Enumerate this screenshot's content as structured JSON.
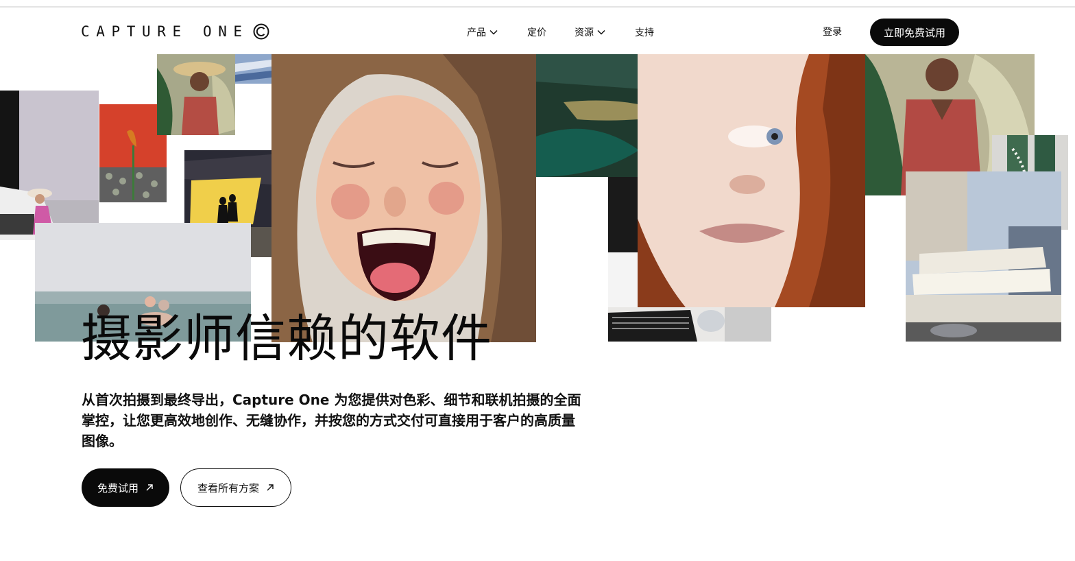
{
  "header": {
    "logo_text": "CAPTURE ONE",
    "nav": [
      {
        "label": "产品",
        "has_dropdown": true
      },
      {
        "label": "定价",
        "has_dropdown": false
      },
      {
        "label": "资源",
        "has_dropdown": true
      },
      {
        "label": "支持",
        "has_dropdown": false
      }
    ],
    "login_label": "登录",
    "cta_label": "立即免费试用"
  },
  "hero": {
    "title": "摄影师信赖的软件",
    "description": "从首次拍摄到最终导出，Capture One 为您提供对色彩、细节和联机拍摄的全面掌控，让您更高效地创作、无缝协作，并按您的方式交付可直接用于客户的高质量图像。",
    "primary_button": "免费试用",
    "secondary_button": "查看所有方案"
  },
  "colors": {
    "brand_black": "#0a0a0a",
    "background": "#ffffff"
  }
}
